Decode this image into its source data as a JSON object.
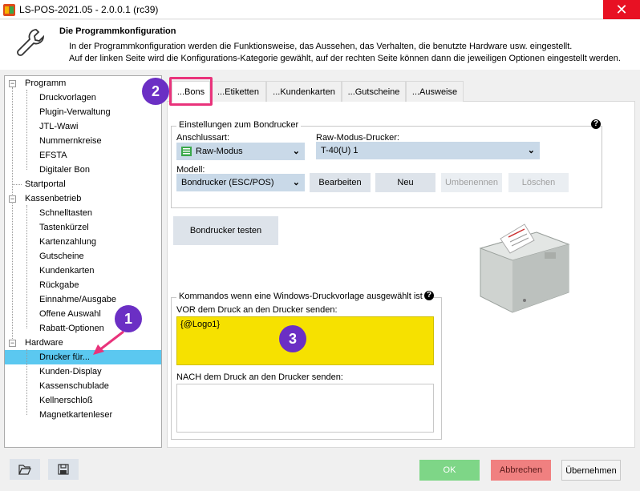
{
  "window": {
    "title": "LS-POS-2021.05 - 2.0.0.1 (rc39)",
    "close_glyph": "✕"
  },
  "header": {
    "title": "Die Programmkonfiguration",
    "line1": "In der Programmkonfiguration werden die Funktionsweise, das Aussehen, das Verhalten, die benutzte Hardware usw. eingestellt.",
    "line2": "Auf der linken Seite wird die Konfigurations-Kategorie gewählt, auf der rechten Seite können dann die jeweiligen Optionen eingestellt werden.",
    "icon": "wrench-icon"
  },
  "tree": {
    "programm": {
      "label": "Programm",
      "children": [
        "Druckvorlagen",
        "Plugin-Verwaltung",
        "JTL-Wawi",
        "Nummernkreise",
        "EFSTA",
        "Digitaler Bon"
      ]
    },
    "startportal": "Startportal",
    "kassenbetrieb": {
      "label": "Kassenbetrieb",
      "children": [
        "Schnelltasten",
        "Tastenkürzel",
        "Kartenzahlung",
        "Gutscheine",
        "Kundenkarten",
        "Rückgabe",
        "Einnahme/Ausgabe",
        "Offene Auswahl",
        "Rabatt-Optionen"
      ]
    },
    "hardware": {
      "label": "Hardware",
      "children": [
        "Drucker für...",
        "Kunden-Display",
        "Kassenschublade",
        "Kellnerschloß",
        "Magnetkartenleser"
      ]
    },
    "expander_glyph": "−"
  },
  "tabs": [
    "...Bons",
    "...Etiketten",
    "...Kundenkarten",
    "...Gutscheine",
    "...Ausweise"
  ],
  "badges": {
    "one": "1",
    "two": "2",
    "three": "3",
    "color": "#6b2fc4"
  },
  "bondrucker": {
    "group_label": "Einstellungen zum Bondrucker",
    "help": "?",
    "anschlussart_label": "Anschlussart:",
    "anschlussart_value": "Raw-Modus",
    "raw_drucker_label": "Raw-Modus-Drucker:",
    "raw_drucker_value": "T-40(U) 1",
    "modell_label": "Modell:",
    "modell_value": "Bondrucker (ESC/POS)",
    "dropdown_glyph": "⌄",
    "buttons": {
      "bearbeiten": "Bearbeiten",
      "neu": "Neu",
      "umbenennen": "Umbenennen",
      "loeschen": "Löschen"
    }
  },
  "test_button": "Bondrucker testen",
  "kommandos": {
    "group_label": "Kommandos wenn eine Windows-Druckvorlage ausgewählt ist",
    "help": "?",
    "vor_label": "VOR dem Druck an den Drucker senden:",
    "vor_value": "{@Logo1}",
    "nach_label": "NACH dem Druck an den Drucker senden:",
    "nach_value": ""
  },
  "footer": {
    "open_icon": "folder-open-icon",
    "save_icon": "save-icon",
    "ok": "OK",
    "abbrechen": "Abbrechen",
    "uebernehmen": "Übernehmen"
  },
  "colors": {
    "accent_highlight": "#e9337b",
    "selected_row": "#5bc8f0",
    "vor_box": "#f6e100",
    "ok_button": "#7ed687",
    "cancel_button": "#f08080"
  }
}
